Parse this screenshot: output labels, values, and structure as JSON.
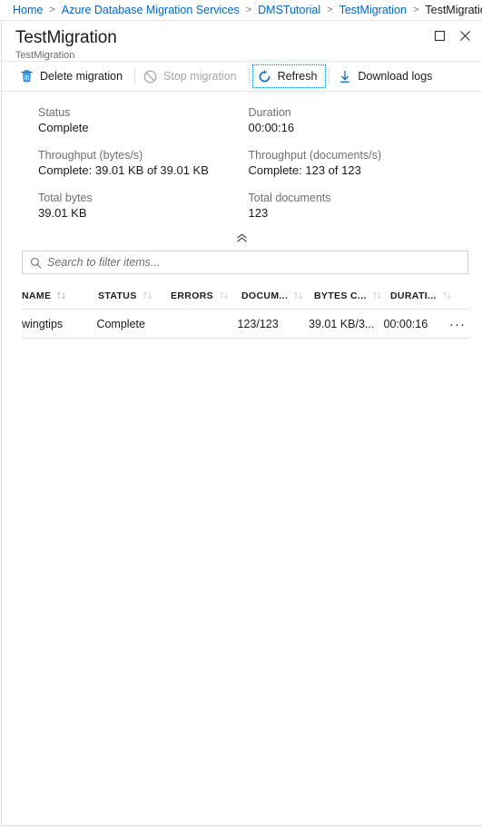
{
  "breadcrumb": {
    "items": [
      {
        "label": "Home",
        "current": false
      },
      {
        "label": "Azure Database Migration Services",
        "current": false
      },
      {
        "label": "DMSTutorial",
        "current": false
      },
      {
        "label": "TestMigration",
        "current": false
      },
      {
        "label": "TestMigration",
        "current": true
      }
    ],
    "separator": ">"
  },
  "blade": {
    "title": "TestMigration",
    "subtitle": "TestMigration",
    "window": {
      "maximize_icon": "maximize-icon",
      "close_icon": "close-icon"
    }
  },
  "toolbar": {
    "delete_label": "Delete migration",
    "delete_icon": "trash-icon",
    "stop_label": "Stop migration",
    "stop_icon": "prohibited-icon",
    "refresh_label": "Refresh",
    "refresh_icon": "refresh-icon",
    "download_label": "Download logs",
    "download_icon": "download-icon"
  },
  "stats": {
    "left": [
      {
        "label": "Status",
        "value": "Complete"
      },
      {
        "label": "Throughput (bytes/s)",
        "value": "Complete: 39.01 KB of 39.01 KB"
      },
      {
        "label": "Total bytes",
        "value": "39.01 KB"
      }
    ],
    "right": [
      {
        "label": "Duration",
        "value": "00:00:16"
      },
      {
        "label": "Throughput (documents/s)",
        "value": "Complete: 123 of 123"
      },
      {
        "label": "Total documents",
        "value": "123"
      }
    ],
    "collapse_icon": "chevron-double-up-icon"
  },
  "search": {
    "placeholder": "Search to filter items...",
    "value": "",
    "icon": "search-icon"
  },
  "table": {
    "columns": [
      {
        "label": "NAME"
      },
      {
        "label": "STATUS"
      },
      {
        "label": "ERRORS"
      },
      {
        "label": "DOCUM..."
      },
      {
        "label": "BYTES C..."
      },
      {
        "label": "DURATI..."
      }
    ],
    "rows": [
      {
        "name": "wingtips",
        "status": "Complete",
        "errors": "",
        "documents": "123/123",
        "bytes": "39.01 KB/3...",
        "duration": "00:00:16",
        "menu": "..."
      }
    ]
  },
  "colors": {
    "accent": "#0078d4",
    "link": "#0066cc",
    "text": "#1b1b1b",
    "muted": "#707070",
    "disabled": "#a6a6a6",
    "border": "#e2e2e2"
  }
}
